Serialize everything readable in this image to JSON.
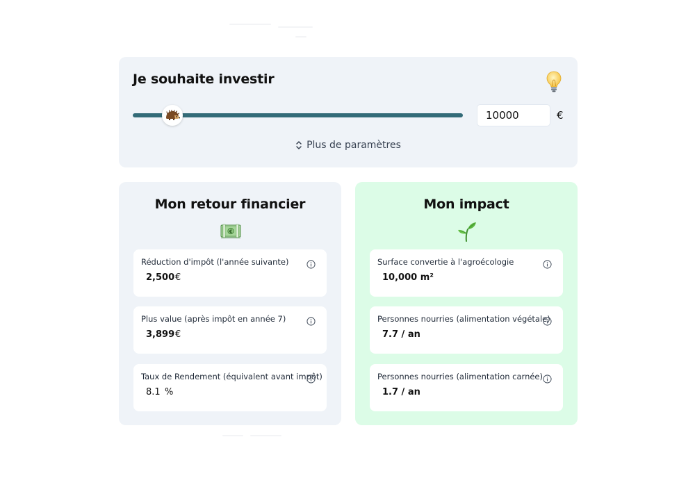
{
  "investment": {
    "title": "Je souhaite investir",
    "amount_value": "10000",
    "currency": "€",
    "more_params_label": "Plus de paramètres",
    "slider_fraction": 0.12
  },
  "financial": {
    "title": "Mon retour financier",
    "stats": [
      {
        "label": "Réduction d'impôt (l'année suivante)",
        "value": "2,500",
        "unit": "€"
      },
      {
        "label": "Plus value (après impôt en année 7)",
        "value": "3,899",
        "unit": "€"
      },
      {
        "label": "Taux de Rendement (équivalent avant impôt)",
        "value": "8.1",
        "unit": "%"
      }
    ]
  },
  "impact": {
    "title": "Mon impact",
    "stats": [
      {
        "label": "Surface convertie à l'agroécologie",
        "value": "10,000 m²"
      },
      {
        "label": "Personnes nourries (alimentation végétale)",
        "value": "7.7 / an"
      },
      {
        "label": "Personnes nourries (alimentation carnée)",
        "value": "1.7 / an"
      }
    ]
  },
  "colors": {
    "slider": "#336b78",
    "panel_gray": "#eff3f8",
    "panel_green": "#dcfce7"
  },
  "icons": [
    "bulb-icon",
    "hedgehog-icon",
    "chevron-updown-icon",
    "banknote-icon",
    "seedling-icon",
    "info-icon"
  ]
}
